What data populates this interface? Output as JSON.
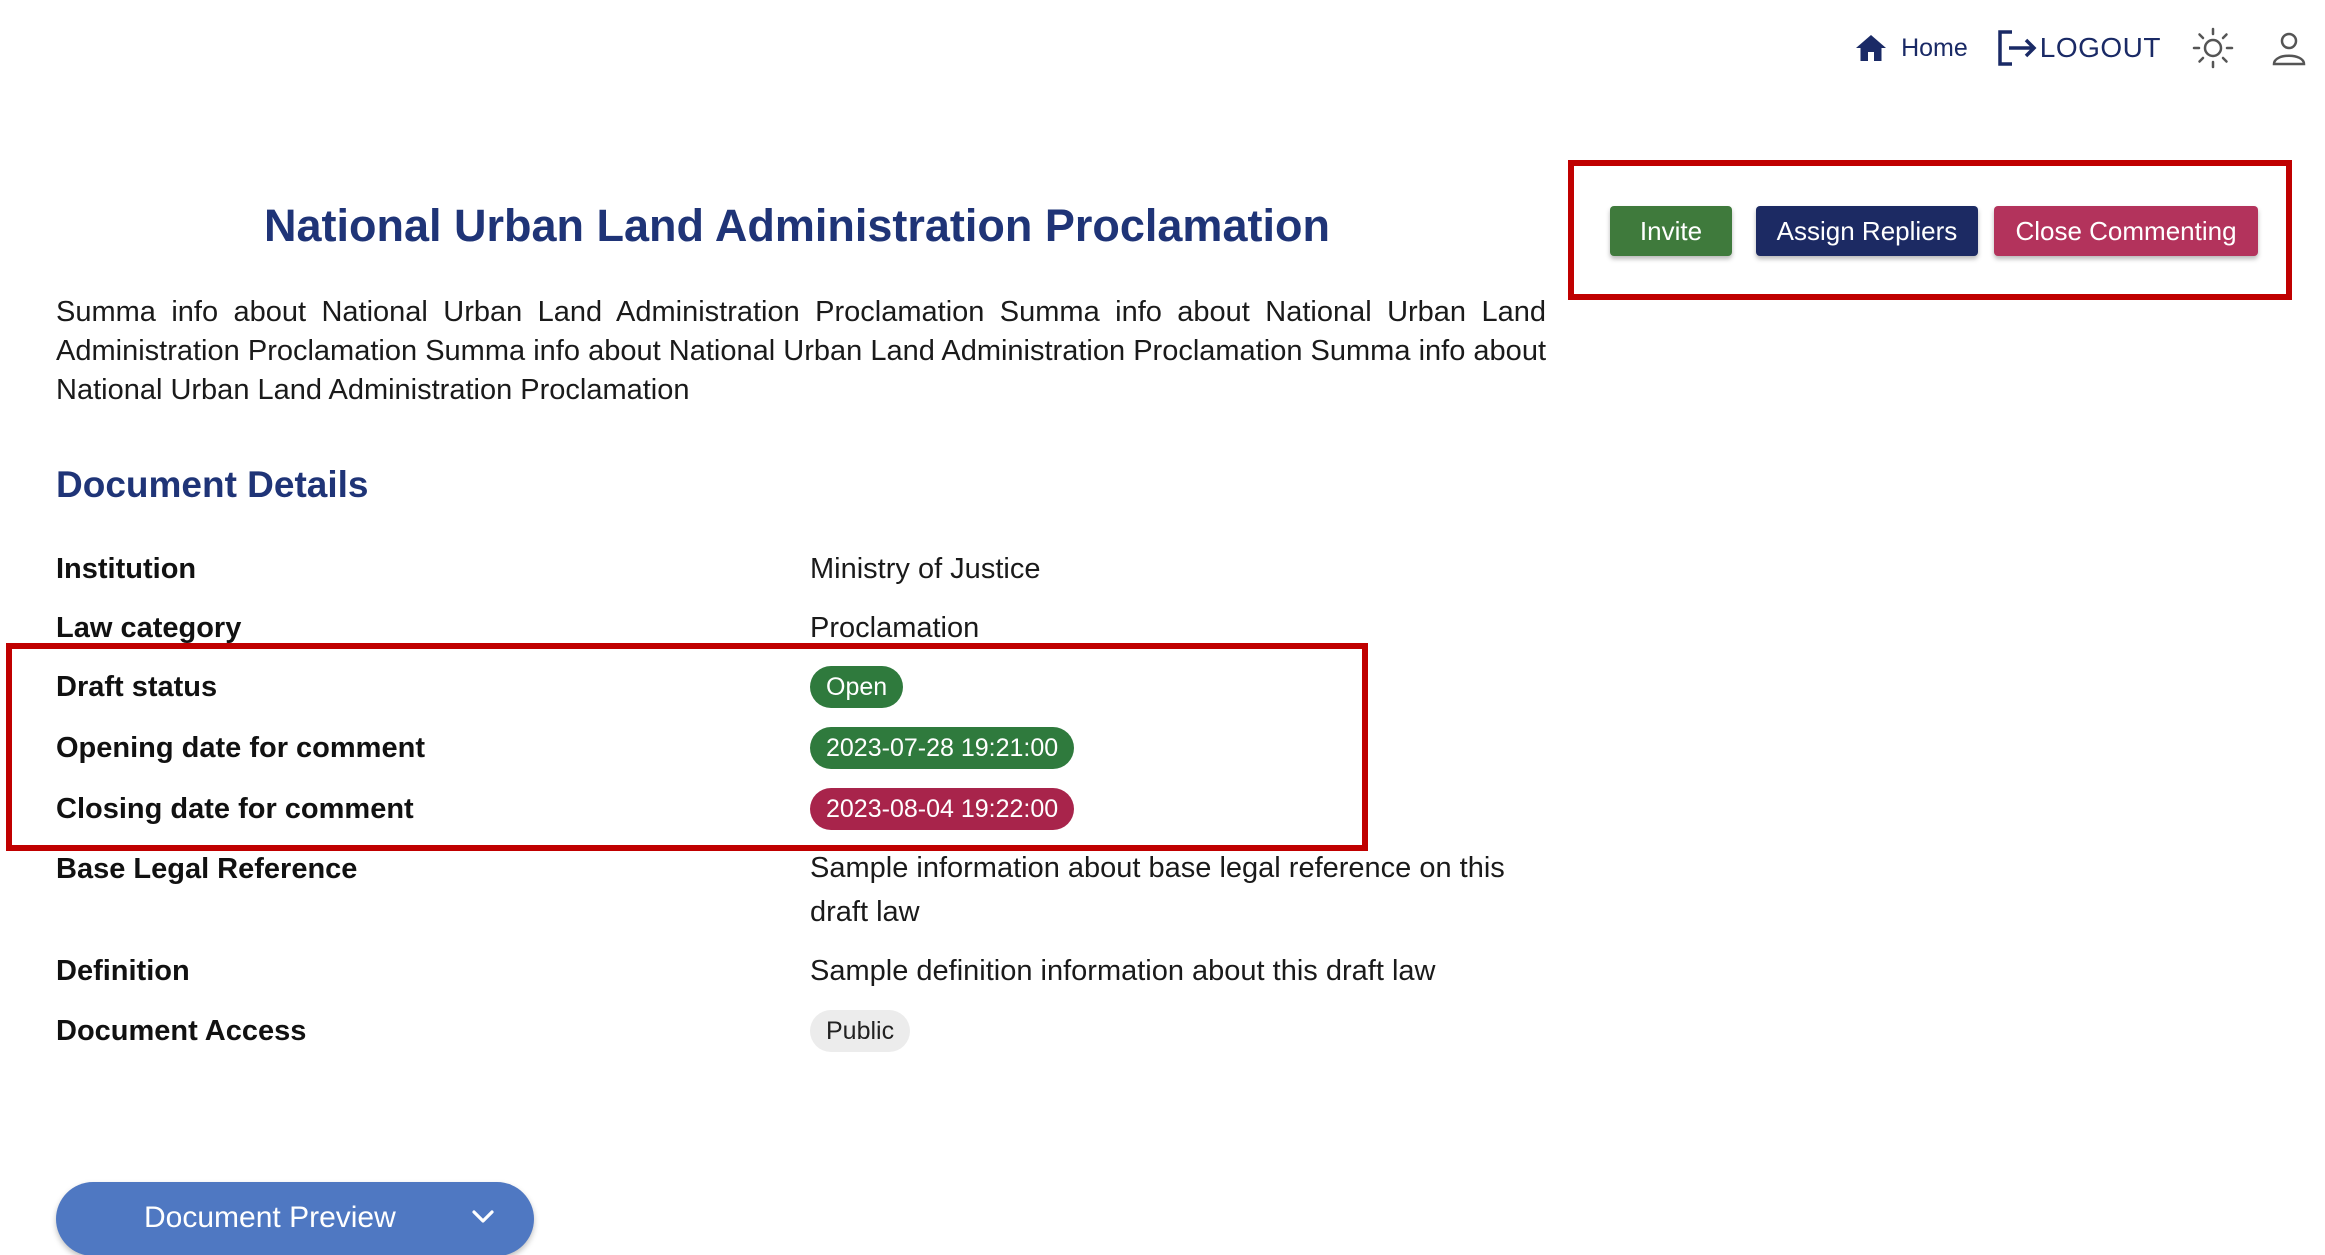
{
  "nav": {
    "home_label": "Home",
    "logout_label": "LOGOUT",
    "icons": [
      "home-icon",
      "logout-icon",
      "sun-icon",
      "user-icon"
    ],
    "accent_color": "#1a2a66"
  },
  "document": {
    "title": "National Urban Land Administration Proclamation",
    "summary": "Summa info about National Urban Land Administration Proclamation Summa info about National Urban Land Administration Proclamation Summa info about National Urban Land Administration Proclamation Summa info about National Urban Land Administration Proclamation"
  },
  "actions": {
    "invite_label": "Invite",
    "assign_label": "Assign Repliers",
    "close_label": "Close Commenting",
    "colors": {
      "invite": "#3f7a3c",
      "assign": "#1c2a63",
      "close": "#b3335c"
    }
  },
  "details": {
    "section_title": "Document Details",
    "rows": [
      {
        "label": "Institution",
        "value": "Ministry of Justice"
      },
      {
        "label": "Law category",
        "value": "Proclamation"
      },
      {
        "label": "Draft status",
        "value": "Open",
        "badge_color": "#2f7a3d"
      },
      {
        "label": "Opening date for comment",
        "value": "2023-07-28 19:21:00",
        "badge_color": "#2f7a3d"
      },
      {
        "label": "Closing date for comment",
        "value": "2023-08-04 19:22:00",
        "badge_color": "#a8244b"
      },
      {
        "label": "Base Legal Reference",
        "value": "Sample information about base legal reference on this draft law"
      },
      {
        "label": "Definition",
        "value": "Sample definition information about this draft law"
      },
      {
        "label": "Document Access",
        "value": "Public",
        "badge_color": "#ececec"
      }
    ]
  },
  "preview": {
    "label": "Document Preview",
    "icon": "chevron-down-icon",
    "color": "#4f78c2"
  },
  "highlight_color": "#c00000"
}
